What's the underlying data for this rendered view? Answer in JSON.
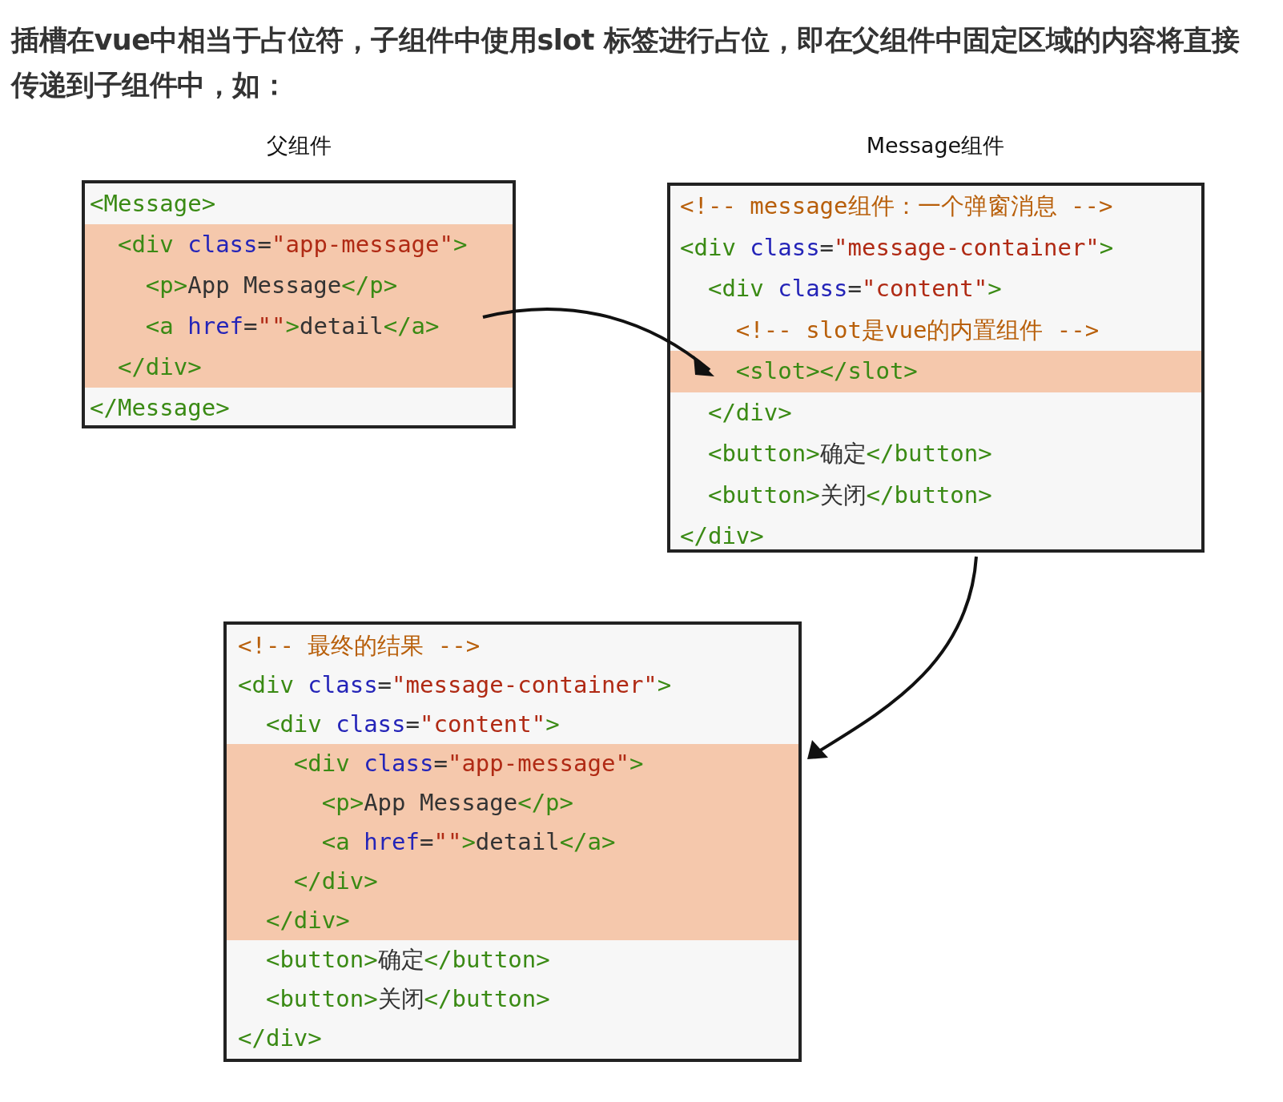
{
  "intro": "插槽在vue中相当于占位符，子组件中使用slot 标签进行占位，即在父组件中固定区域的内容将直接传递到子组件中，如：",
  "diagram": {
    "boxes": [
      {
        "label": "父组件",
        "lines": [
          {
            "highlighted": false,
            "tokens": [
              {
                "kind": "tag",
                "text": "<Message>"
              }
            ]
          },
          {
            "highlighted": true,
            "tokens": [
              {
                "kind": "tag",
                "text": "  <div"
              },
              {
                "kind": "attr",
                "text": " class"
              },
              {
                "kind": "punct",
                "text": "="
              },
              {
                "kind": "string",
                "text": "\"app-message\""
              },
              {
                "kind": "tag",
                "text": ">"
              }
            ]
          },
          {
            "highlighted": true,
            "tokens": [
              {
                "kind": "tag",
                "text": "    <p>"
              },
              {
                "kind": "text",
                "text": "App Message"
              },
              {
                "kind": "tag",
                "text": "</p>"
              }
            ]
          },
          {
            "highlighted": true,
            "tokens": [
              {
                "kind": "tag",
                "text": "    <a"
              },
              {
                "kind": "attr",
                "text": " href"
              },
              {
                "kind": "punct",
                "text": "="
              },
              {
                "kind": "string",
                "text": "\"\""
              },
              {
                "kind": "tag",
                "text": ">"
              },
              {
                "kind": "text",
                "text": "detail"
              },
              {
                "kind": "tag",
                "text": "</a>"
              }
            ]
          },
          {
            "highlighted": true,
            "tokens": [
              {
                "kind": "tag",
                "text": "  </div>"
              }
            ]
          },
          {
            "highlighted": false,
            "tokens": [
              {
                "kind": "tag",
                "text": "</Message>"
              }
            ]
          }
        ]
      },
      {
        "label": "Message组件",
        "lines": [
          {
            "highlighted": false,
            "tokens": [
              {
                "kind": "comment",
                "text": "<!-- message组件：一个弹窗消息 -->"
              }
            ]
          },
          {
            "highlighted": false,
            "tokens": [
              {
                "kind": "tag",
                "text": "<div"
              },
              {
                "kind": "attr",
                "text": " class"
              },
              {
                "kind": "punct",
                "text": "="
              },
              {
                "kind": "string",
                "text": "\"message-container\""
              },
              {
                "kind": "tag",
                "text": ">"
              }
            ]
          },
          {
            "highlighted": false,
            "tokens": [
              {
                "kind": "tag",
                "text": "  <div"
              },
              {
                "kind": "attr",
                "text": " class"
              },
              {
                "kind": "punct",
                "text": "="
              },
              {
                "kind": "string",
                "text": "\"content\""
              },
              {
                "kind": "tag",
                "text": ">"
              }
            ]
          },
          {
            "highlighted": false,
            "tokens": [
              {
                "kind": "comment",
                "text": "    <!-- slot是vue的内置组件 -->"
              }
            ]
          },
          {
            "highlighted": true,
            "tokens": [
              {
                "kind": "tag",
                "text": "    <slot></slot>"
              }
            ]
          },
          {
            "highlighted": false,
            "tokens": [
              {
                "kind": "tag",
                "text": "  </div>"
              }
            ]
          },
          {
            "highlighted": false,
            "tokens": [
              {
                "kind": "tag",
                "text": "  <button>"
              },
              {
                "kind": "text",
                "text": "确定"
              },
              {
                "kind": "tag",
                "text": "</button>"
              }
            ]
          },
          {
            "highlighted": false,
            "tokens": [
              {
                "kind": "tag",
                "text": "  <button>"
              },
              {
                "kind": "text",
                "text": "关闭"
              },
              {
                "kind": "tag",
                "text": "</button>"
              }
            ]
          },
          {
            "highlighted": false,
            "tokens": [
              {
                "kind": "tag",
                "text": "</div>"
              }
            ]
          }
        ]
      },
      {
        "lines": [
          {
            "highlighted": false,
            "tokens": [
              {
                "kind": "comment",
                "text": "<!-- 最终的结果 -->"
              }
            ]
          },
          {
            "highlighted": false,
            "tokens": [
              {
                "kind": "tag",
                "text": "<div"
              },
              {
                "kind": "attr",
                "text": " class"
              },
              {
                "kind": "punct",
                "text": "="
              },
              {
                "kind": "string",
                "text": "\"message-container\""
              },
              {
                "kind": "tag",
                "text": ">"
              }
            ]
          },
          {
            "highlighted": false,
            "tokens": [
              {
                "kind": "tag",
                "text": "  <div"
              },
              {
                "kind": "attr",
                "text": " class"
              },
              {
                "kind": "punct",
                "text": "="
              },
              {
                "kind": "string",
                "text": "\"content\""
              },
              {
                "kind": "tag",
                "text": ">"
              }
            ]
          },
          {
            "highlighted": true,
            "tokens": [
              {
                "kind": "tag",
                "text": "    <div"
              },
              {
                "kind": "attr",
                "text": " class"
              },
              {
                "kind": "punct",
                "text": "="
              },
              {
                "kind": "string",
                "text": "\"app-message\""
              },
              {
                "kind": "tag",
                "text": ">"
              }
            ]
          },
          {
            "highlighted": true,
            "tokens": [
              {
                "kind": "tag",
                "text": "      <p>"
              },
              {
                "kind": "text",
                "text": "App Message"
              },
              {
                "kind": "tag",
                "text": "</p>"
              }
            ]
          },
          {
            "highlighted": true,
            "tokens": [
              {
                "kind": "tag",
                "text": "      <a"
              },
              {
                "kind": "attr",
                "text": " href"
              },
              {
                "kind": "punct",
                "text": "="
              },
              {
                "kind": "string",
                "text": "\"\""
              },
              {
                "kind": "tag",
                "text": ">"
              },
              {
                "kind": "text",
                "text": "detail"
              },
              {
                "kind": "tag",
                "text": "</a>"
              }
            ]
          },
          {
            "highlighted": true,
            "tokens": [
              {
                "kind": "tag",
                "text": "    </div>"
              }
            ]
          },
          {
            "highlighted": true,
            "tokens": [
              {
                "kind": "tag",
                "text": "  </div>"
              }
            ]
          },
          {
            "highlighted": false,
            "tokens": [
              {
                "kind": "tag",
                "text": "  <button>"
              },
              {
                "kind": "text",
                "text": "确定"
              },
              {
                "kind": "tag",
                "text": "</button>"
              }
            ]
          },
          {
            "highlighted": false,
            "tokens": [
              {
                "kind": "tag",
                "text": "  <button>"
              },
              {
                "kind": "text",
                "text": "关闭"
              },
              {
                "kind": "tag",
                "text": "</button>"
              }
            ]
          },
          {
            "highlighted": false,
            "tokens": [
              {
                "kind": "tag",
                "text": "</div>"
              }
            ]
          }
        ]
      }
    ]
  }
}
